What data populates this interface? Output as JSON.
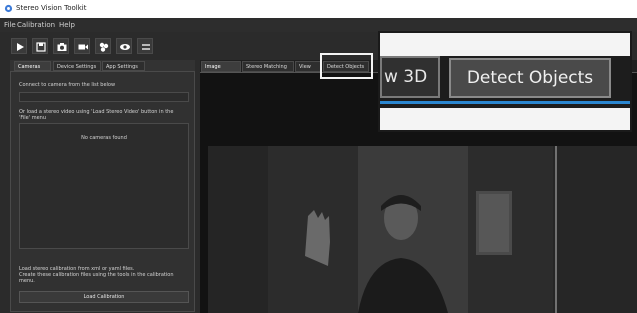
{
  "window": {
    "title": "Stereo Vision Toolkit"
  },
  "menu": {
    "items": [
      "File",
      "Calibration",
      "Help"
    ]
  },
  "toolbar": {
    "buttons": [
      {
        "icon": "play-icon"
      },
      {
        "icon": "save-icon"
      },
      {
        "icon": "camera-icon"
      },
      {
        "icon": "video-icon"
      },
      {
        "icon": "stereo-matching-icon"
      },
      {
        "icon": "eye-icon"
      },
      {
        "icon": "swap-icon"
      }
    ]
  },
  "left_panel": {
    "tabs": [
      "Cameras",
      "Device Settings",
      "App Settings"
    ],
    "connect_text": "Connect to camera from the list below",
    "or_load_text_1": "Or load a stereo video using 'Load Stereo Video' button in the",
    "or_load_text_2": "'File' menu",
    "cameras_list_empty": "No cameras found",
    "calib_text_1": "Load stereo calibration from xml or yaml files.",
    "calib_text_2": "Create these calibration files using the tools in the calibration",
    "calib_text_3": "menu.",
    "load_calibration_label": "Load Calibration"
  },
  "right_panel": {
    "tabs": [
      "Image Viewer",
      "Stereo Matching",
      "View 3D",
      "Detect Objects"
    ]
  },
  "callout": {
    "tab_partial": "w 3D",
    "tab_detect": "Detect Objects"
  },
  "colors": {
    "accent": "#2b87d1",
    "background": "#2b2b2b"
  }
}
